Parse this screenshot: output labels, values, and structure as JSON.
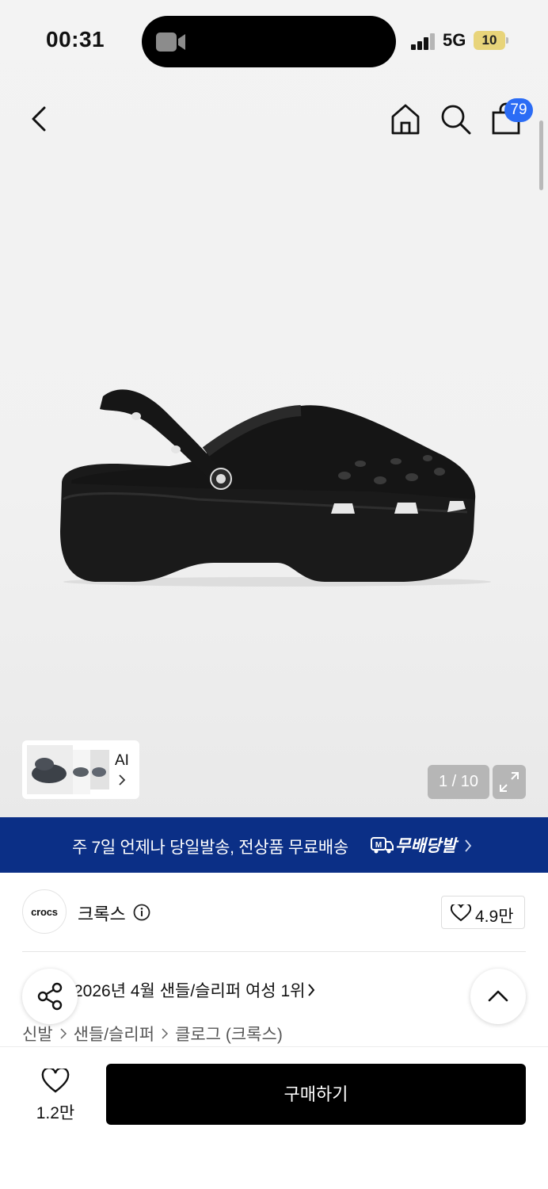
{
  "status_bar": {
    "time": "00:31",
    "network": "5G",
    "battery": "10",
    "battery_color": "#e8d47a"
  },
  "nav": {
    "cart_count": "79",
    "icons": [
      "back-chevron-icon",
      "home-icon",
      "search-icon",
      "shopping-bag-icon"
    ],
    "badge_color": "#2b6cf5"
  },
  "gallery": {
    "counter": "1 / 10",
    "ai_label": "AI"
  },
  "banner": {
    "text": "주 7일 언제나 당일발송, 전상품 무료배송",
    "logo_label": "무배당발",
    "background": "#0b2f86"
  },
  "brand": {
    "logo_text": "crocs",
    "name": "크록스",
    "likes": "4.9만"
  },
  "ranking": {
    "text": "2026년 4월 샌들/슬리퍼 여성 1위"
  },
  "breadcrumb": [
    "신발",
    "샌들/슬리퍼",
    "클로그 (크록스)"
  ],
  "bottom_bar": {
    "wish_count": "1.2만",
    "buy_label": "구매하기"
  }
}
